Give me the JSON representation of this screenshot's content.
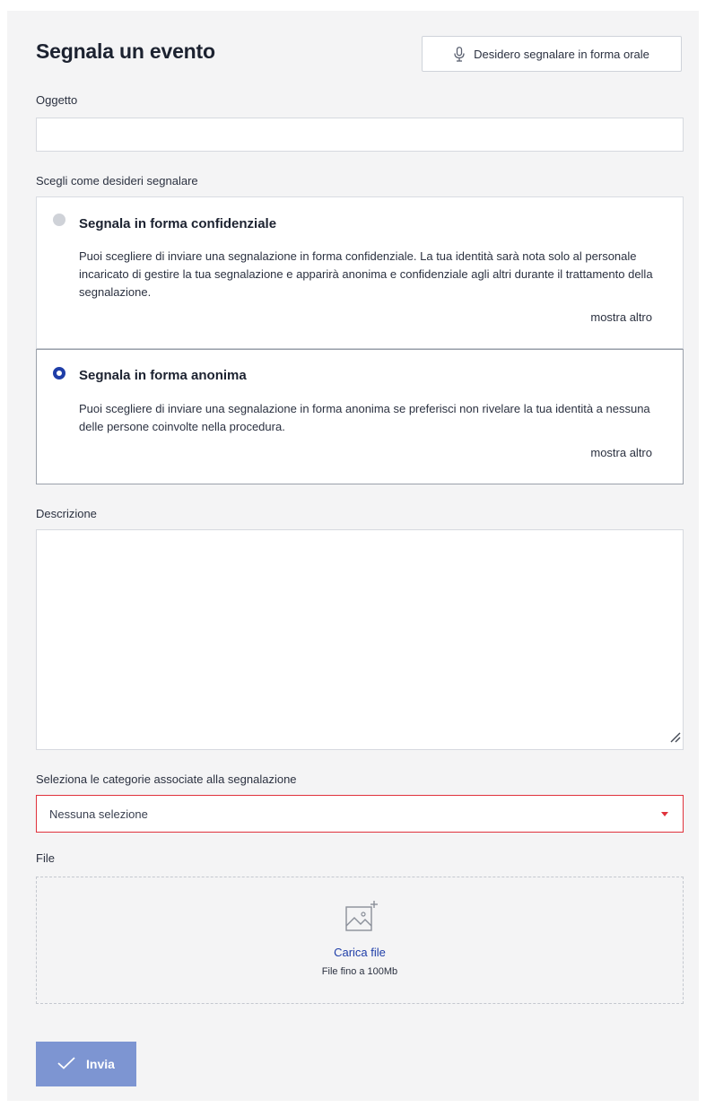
{
  "header": {
    "title": "Segnala un evento",
    "oral_button_label": "Desidero segnalare in forma orale",
    "oral_button_icon": "microphone-icon"
  },
  "subject": {
    "label": "Oggetto",
    "value": ""
  },
  "report_mode": {
    "label": "Scegli come desideri segnalare",
    "options": [
      {
        "title": "Segnala in forma confidenziale",
        "description": "Puoi scegliere di inviare una segnalazione in forma confidenziale. La tua identità sarà nota solo al personale incaricato di gestire la tua segnalazione e apparirà anonima e confidenziale agli altri durante il trattamento della segnalazione.",
        "show_more": "mostra altro",
        "selected": false
      },
      {
        "title": "Segnala in forma anonima",
        "description": "Puoi scegliere di inviare una segnalazione in forma anonima se preferisci non rivelare la tua identità a nessuna delle persone coinvolte nella procedura.",
        "show_more": "mostra altro",
        "selected": true
      }
    ]
  },
  "description": {
    "label": "Descrizione",
    "value": ""
  },
  "categories": {
    "label": "Seleziona le categorie associate alla segnalazione",
    "selected_value": "Nessuna selezione",
    "border_color": "#e0323c"
  },
  "file": {
    "label": "File",
    "upload_link": "Carica file",
    "hint": "File fino a 100Mb",
    "icon": "image-add-icon"
  },
  "submit": {
    "label": "Invia",
    "icon": "checkmark-icon",
    "color": "#7d95d2"
  },
  "colors": {
    "accent": "#1f3ea8",
    "background": "#f4f4f5"
  }
}
